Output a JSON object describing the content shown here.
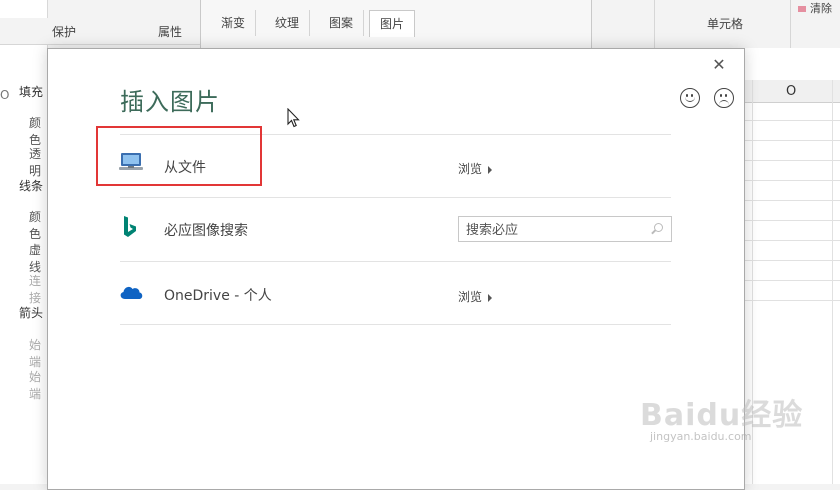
{
  "background": {
    "ribbon": {
      "cells_group_label": "单元格",
      "clear_label": "清除"
    },
    "sheet": {
      "column_label": "O"
    },
    "format_pane": {
      "tabs": [
        "保护",
        "属性"
      ],
      "items": [
        {
          "label": "填充",
          "kind": "head"
        },
        {
          "label": "颜色",
          "kind": "sub"
        },
        {
          "label": "透明",
          "kind": "sub"
        },
        {
          "label": "线条",
          "kind": "head"
        },
        {
          "label": "颜色",
          "kind": "sub"
        },
        {
          "label": "虚线",
          "kind": "sub"
        },
        {
          "label": "连接",
          "kind": "dim"
        },
        {
          "label": "箭头",
          "kind": "head"
        },
        {
          "label": "始端",
          "kind": "dim"
        },
        {
          "label": "始端",
          "kind": "dim"
        }
      ],
      "left_edge_label": "O"
    },
    "format_dialog": {
      "tabs": [
        "渐变",
        "纹理",
        "图案",
        "图片"
      ],
      "active_tab": "图片"
    }
  },
  "insert_picture": {
    "title": "插入图片",
    "rows": [
      {
        "label": "从文件",
        "action": "浏览",
        "icon": "computer-icon"
      },
      {
        "label": "必应图像搜索",
        "search_placeholder": "搜索必应",
        "icon": "bing-icon"
      },
      {
        "label": "OneDrive - 个人",
        "action": "浏览",
        "icon": "onedrive-icon"
      }
    ],
    "feedback": [
      "smile-icon",
      "frown-icon"
    ]
  },
  "watermark": {
    "text": "Baidu经验",
    "url": "jingyan.baidu.com"
  },
  "colors": {
    "title_green": "#3d6b5a",
    "highlight_red": "#e23636",
    "bing_teal": "#008373",
    "onedrive_blue": "#0f63c3"
  }
}
